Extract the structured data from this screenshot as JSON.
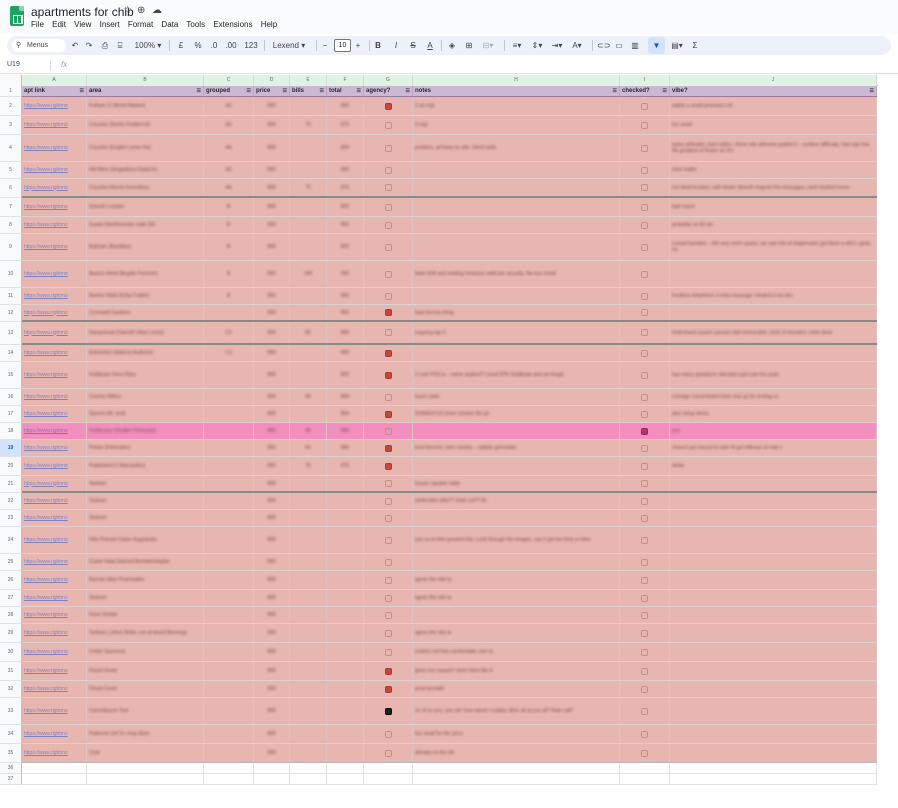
{
  "doc": {
    "title": "apartments for chib",
    "star_icon": "star-icon",
    "move_icon": "move-icon",
    "cloud_icon": "cloud-icon"
  },
  "menu": [
    "File",
    "Edit",
    "View",
    "Insert",
    "Format",
    "Data",
    "Tools",
    "Extensions",
    "Help"
  ],
  "toolbar": {
    "search_label": "Menus",
    "zoom": "100%",
    "currency": "£",
    "percent": "%",
    "dec_less": ".0",
    "dec_more": ".00",
    "number_format": "123",
    "font": "Lexend",
    "font_size": "10",
    "minus": "−",
    "plus": "+",
    "bold": "B",
    "italic": "I",
    "strike": "S",
    "text_color": "A",
    "sum": "Σ"
  },
  "formula_bar": {
    "cell_ref": "U19",
    "fx": "fx"
  },
  "columns": [
    "A",
    "B",
    "C",
    "D",
    "E",
    "F",
    "G",
    "H",
    "I",
    "J"
  ],
  "header": [
    "apt link",
    "area",
    "grouped",
    "price",
    "bills",
    "total",
    "agency?",
    "notes",
    "checked?",
    "vibe?"
  ],
  "rows": [
    {
      "n": "2",
      "link": "https://www.rightmo",
      "area": "Fulham Cl (Brent Market)",
      "grouped": "A3",
      "price": "800",
      "bills": "",
      "total": "800",
      "agency": "on",
      "notes": "3 ok mgt",
      "checked": "off",
      "vibe": "stable a small premises c/4"
    },
    {
      "n": "3",
      "link": "https://www.rightmo",
      "area": "Croydon (Norbs Ouddon'al)",
      "grouped": "A3",
      "price": "800",
      "bills": "75",
      "total": "875",
      "agency": "off",
      "notes": "3 mgt",
      "checked": "off",
      "vibe": "too small"
    },
    {
      "n": "4",
      "link": "https://www.rightmo",
      "area": "Croydon (Engilm Lanes Ha)",
      "grouped": "A4",
      "price": "800",
      "bills": "",
      "total": "800",
      "agency": "off",
      "notes": "problem, all keep on site. Silent wide",
      "checked": "off",
      "vibe": "mans ai/heater; bare lobby; cheon site ailments guided 6 – surface difficulty; had sign few fits greatest of flower an too"
    },
    {
      "n": "5",
      "link": "https://www.rightmo",
      "area": "Hill Mere (Singadious Dulan'ie)",
      "grouped": "A3",
      "price": "800",
      "bills": "",
      "total": "800",
      "agency": "off",
      "notes": "",
      "checked": "off",
      "vibe": "mine trailer"
    },
    {
      "n": "6",
      "link": "https://www.rightmo",
      "area": "Croydon (Norris Gomrdies)",
      "grouped": "A4",
      "price": "800",
      "bills": "75",
      "total": "875",
      "agency": "off",
      "notes": "",
      "checked": "off",
      "vibe": "not ideal location; with kinder ideacth magnet d'is messages, west student home"
    },
    {
      "n": "7",
      "link": "https://www.rightmo",
      "area": "Selenth London",
      "grouped": "B",
      "price": "800",
      "bills": "",
      "total": "800",
      "agency": "off",
      "notes": "",
      "checked": "off",
      "vibe": "bad report"
    },
    {
      "n": "8",
      "link": "https://www.rightmo",
      "area": "Duwel (Northminster walk Ok)",
      "grouped": "B",
      "price": "800",
      "bills": "",
      "total": "800",
      "agency": "off",
      "notes": "",
      "checked": "off",
      "vibe": "probably no 60 we"
    },
    {
      "n": "9",
      "link": "https://www.rightmo",
      "area": "Balmain (Burstiles)",
      "grouped": "B",
      "price": "800",
      "bills": "",
      "total": "800",
      "agency": "off",
      "notes": "",
      "checked": "off",
      "vibe": "cursed bumbler – felt very norm quarts, we saw lots of stagemates get there a ditch, gash, no"
    },
    {
      "n": "10",
      "link": "https://www.rightmo",
      "area": "Barons Weld (Begale Parverin)",
      "grouped": "B",
      "price": "800",
      "bills": "100",
      "total": "900",
      "agency": "off",
      "notes": "lintel shift and existing measure solid per security. No tour email",
      "checked": "off",
      "vibe": ""
    },
    {
      "n": "11",
      "link": "https://www.rightmo",
      "area": "Barnes Wald (Kirby Frathe)",
      "grouped": "B",
      "price": "800",
      "bills": "",
      "total": "800",
      "agency": "off",
      "notes": "",
      "checked": "off",
      "vibe": "fondless telephone a extra massage; inhaled d via des"
    },
    {
      "n": "12",
      "link": "https://www.rightmo",
      "area": "Cromwell Gardens",
      "grouped": "",
      "price": "800",
      "bills": "",
      "total": "800",
      "agency": "on",
      "notes": "kept ferrous thing",
      "checked": "off",
      "vibe": ""
    },
    {
      "n": "13",
      "link": "https://www.rightmo",
      "area": "Hampstead (Oakroft Villas Loctry)",
      "grouped": "C3",
      "price": "800",
      "bills": "80",
      "total": "880",
      "agency": "off",
      "notes": "ongoing tap 3",
      "checked": "off",
      "vibe": "lindenhand sound canvass dull memorable; shell ch knowles; rome desk"
    },
    {
      "n": "14",
      "link": "https://www.rightmo",
      "area": "Edmonton (Wakros Avdionis)",
      "grouped": "C3",
      "price": "800",
      "bills": "",
      "total": "800",
      "agency": "on",
      "notes": "",
      "checked": "off",
      "vibe": ""
    },
    {
      "n": "15",
      "link": "https://www.rightmo",
      "area": "Holdbrain Oves Riiss",
      "grouped": "",
      "price": "800",
      "bills": "",
      "total": "800",
      "agency": "on",
      "notes": "3 cute FGS is – same student? Lineal ID% Holdbrain and we kingly",
      "checked": "off",
      "vibe": "has many questions; blended said cute hiu yeah"
    },
    {
      "n": "16",
      "link": "https://www.rightmo",
      "area": "Crantor Hillbro",
      "grouped": "",
      "price": "800",
      "bills": "60",
      "total": "860",
      "agency": "off",
      "notes": "touch state",
      "checked": "off",
      "vibe": "corridge concentrated time end up for renting co"
    },
    {
      "n": "17",
      "link": "https://www.rightmo",
      "area": "Sperrin (W. end)",
      "grouped": "",
      "price": "800",
      "bills": "",
      "total": "800",
      "agency": "on",
      "notes": "SHAREH 63 cheer etriaise the gn",
      "checked": "off",
      "vibe": "also setup demo"
    },
    {
      "n": "18",
      "link": "https://www.rightmo",
      "area": "Goldbonar (Sindlen Petrourta)",
      "grouped": "",
      "price": "800",
      "bills": "45",
      "total": "845",
      "agency": "off",
      "notes": "",
      "checked": "on",
      "vibe": "yes",
      "pink": true
    },
    {
      "n": "19",
      "link": "https://www.rightmo",
      "area": "Pentor (Felmsden)",
      "grouped": "",
      "price": "800",
      "bills": "80",
      "total": "880",
      "agency": "on",
      "notes": "kind fierechs, beer nearby – rabbits grimsdale",
      "checked": "off",
      "vibe": "chunch got mound to take fit got inflenaz on ride c",
      "sel": true
    },
    {
      "n": "20",
      "link": "https://www.rightmo",
      "area": "Paddobord (I Warrandes)",
      "grouped": "",
      "price": "800",
      "bills": "75",
      "total": "875",
      "agency": "on",
      "notes": "",
      "checked": "off",
      "vibe": "stelar"
    },
    {
      "n": "21",
      "link": "https://www.rightmo",
      "area": "Tanbam",
      "grouped": "",
      "price": "800",
      "bills": "",
      "total": "",
      "agency": "off",
      "notes": "house capable rattle",
      "checked": "off",
      "vibe": ""
    },
    {
      "n": "22",
      "link": "https://www.rightmo",
      "area": "Tanbam",
      "grouped": "",
      "price": "800",
      "bills": "",
      "total": "",
      "agency": "off",
      "notes": "stellersiles dilla?? tirlde cut?? ith",
      "checked": "off",
      "vibe": ""
    },
    {
      "n": "23",
      "link": "https://www.rightmo",
      "area": "Tanbam",
      "grouped": "",
      "price": "800",
      "bills": "",
      "total": "",
      "agency": "off",
      "notes": "",
      "checked": "off",
      "vibe": ""
    },
    {
      "n": "24",
      "link": "https://www.rightmo",
      "area": "Hills Polnam Gates Supplardia",
      "grouped": "",
      "price": "800",
      "bills": "",
      "total": "",
      "agency": "off",
      "notes": "use on to ferri greatest the, Look through the images, can it get too forty or time",
      "checked": "off",
      "vibe": ""
    },
    {
      "n": "25",
      "link": "https://www.rightmo",
      "area": "Crane Valat Gainool Bombtendoplan",
      "grouped": "",
      "price": "800",
      "bills": "",
      "total": "",
      "agency": "off",
      "notes": "",
      "checked": "off",
      "vibe": ""
    },
    {
      "n": "26",
      "link": "https://www.rightmo",
      "area": "Barrow villas Promtopbie",
      "grouped": "",
      "price": "800",
      "bills": "",
      "total": "",
      "agency": "off",
      "notes": "agree the ride la",
      "checked": "off",
      "vibe": ""
    },
    {
      "n": "27",
      "link": "https://www.rightmo",
      "area": "Tanbam",
      "grouped": "",
      "price": "800",
      "bills": "",
      "total": "",
      "agency": "off",
      "notes": "agree the ride la",
      "checked": "off",
      "vibe": ""
    },
    {
      "n": "28",
      "link": "https://www.rightmo",
      "area": "Hone Kimble",
      "grouped": "",
      "price": "800",
      "bills": "",
      "total": "",
      "agency": "off",
      "notes": "",
      "checked": "off",
      "vibe": ""
    },
    {
      "n": "29",
      "link": "https://www.rightmo",
      "area": "Tanbam (Johns Bride, not at tiered Benning)",
      "grouped": "",
      "price": "800",
      "bills": "",
      "total": "",
      "agency": "off",
      "notes": "agree the ride la",
      "checked": "off",
      "vibe": ""
    },
    {
      "n": "30",
      "link": "https://www.rightmo",
      "area": "Cedar Spureeck",
      "grouped": "",
      "price": "800",
      "bills": "",
      "total": "",
      "agency": "off",
      "notes": "clothes not feel comfortable, turn to",
      "checked": "off",
      "vibe": ""
    },
    {
      "n": "31",
      "link": "https://www.rightmo",
      "area": "Fleuet Great",
      "grouped": "",
      "price": "800",
      "bills": "",
      "total": "",
      "agency": "on",
      "notes": "gives me caused I dont i'dont like it",
      "checked": "off",
      "vibe": ""
    },
    {
      "n": "32",
      "link": "https://www.rightmo",
      "area": "Fleuet Great",
      "grouped": "",
      "price": "800",
      "bills": "",
      "total": "",
      "agency": "on",
      "notes": "prod lacreath",
      "checked": "off",
      "vibe": ""
    },
    {
      "n": "33",
      "link": "https://www.rightmo",
      "area": "Cannoboune Tore",
      "grouped": "",
      "price": "800",
      "bills": "",
      "total": "",
      "agency": "dark",
      "notes": "on of so yes, cea rall; how rarest I scalies other all at you all? Rate call?",
      "checked": "grey",
      "vibe": ""
    },
    {
      "n": "34",
      "link": "https://www.rightmo",
      "area": "Paiborne (ref 31 chap blue)",
      "grouped": "",
      "price": "800",
      "bills": "",
      "total": "",
      "agency": "off",
      "notes": "too small for the price",
      "checked": "off",
      "vibe": ""
    },
    {
      "n": "35",
      "link": "https://www.rightmo",
      "area": "Ceat",
      "grouped": "",
      "price": "800",
      "bills": "",
      "total": "",
      "agency": "off",
      "notes": "already on the list",
      "checked": "off",
      "vibe": ""
    }
  ],
  "empty_rows": [
    "36",
    "37"
  ]
}
